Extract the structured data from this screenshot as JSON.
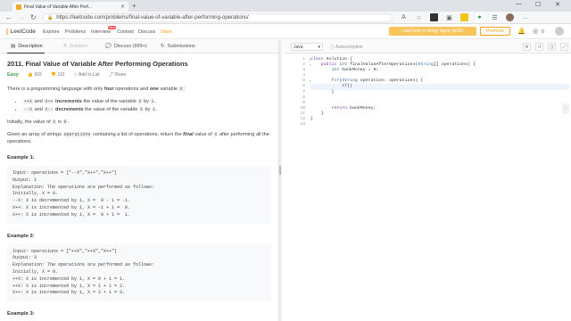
{
  "browser": {
    "tab_title": "Final Value of Variable After Perf...",
    "url": "https://leetcode.com/problems/final-value-of-variable-after-performing-operations/",
    "new_tab": "+",
    "win_min": "—",
    "win_max": "☐",
    "win_close": "✕"
  },
  "nav": {
    "logo": "LeetCode",
    "links": [
      "Explore",
      "Problems",
      "Interview",
      "Contest",
      "Discuss",
      "Store"
    ],
    "new_badge": "New",
    "promo": "LeetCode is hiring! Apply NOW.",
    "premium": "Premium",
    "coin_count": "0"
  },
  "left_tabs": {
    "description": "Description",
    "solution": "Solution",
    "discuss": "Discuss (999+)",
    "submissions": "Submissions"
  },
  "problem": {
    "title": "2011. Final Value of Variable After Performing Operations",
    "difficulty": "Easy",
    "likes": "692",
    "dislikes": "110",
    "add_to_list": "Add to List",
    "share": "Share",
    "intro_a": "There is a programming language with only ",
    "intro_b": "four",
    "intro_c": " operations and ",
    "intro_d": "one",
    "intro_e": " variable ",
    "intro_x": "X",
    "intro_f": ":",
    "bullet1_op1": "++X",
    "bullet1_and": " and ",
    "bullet1_op2": "X++",
    "bullet1_verb": " increments",
    "bullet1_rest": " the value of the variable ",
    "bullet1_x": "X",
    "bullet1_by": " by ",
    "bullet1_n": "1",
    "bullet2_op1": "--X",
    "bullet2_and": " and ",
    "bullet2_op2": "X--",
    "bullet2_verb": " decrements",
    "bullet2_rest": " the value of the variable ",
    "bullet2_x": "X",
    "bullet2_by": " by ",
    "bullet2_n": "1",
    "initial_a": "Initially, the value of ",
    "initial_x": "X",
    "initial_b": " is ",
    "initial_v": "0",
    "initial_c": ".",
    "given_a": "Given an array of strings ",
    "given_ops": "operations",
    "given_b": " containing a list of operations, return the ",
    "given_final": "final",
    "given_c": " value of ",
    "given_x": "X",
    "given_d": " after performing all the operations.",
    "example1_title": "Example 1:",
    "example1_box": "Input: operations = [\"--X\",\"X++\",\"X++\"]\nOutput: 1\nExplanation: The operations are performed as follows:\nInitially, X = 0.\n--X: X is decremented by 1, X =  0 - 1 = -1.\nX++: X is incremented by 1, X = -1 + 1 =  0.\nX++: X is incremented by 1, X =  0 + 1 =  1.",
    "example2_title": "Example 2:",
    "example2_box": "Input: operations = [\"++X\",\"++X\",\"X++\"]\nOutput: 3\nExplanation: The operations are performed as follows:\nInitially, X = 0.\n++X: X is incremented by 1, X = 0 + 1 = 1.\n++X: X is incremented by 1, X = 1 + 1 = 2.\nX++: X is incremented by 1, X = 2 + 1 = 3.",
    "example3_title": "Example 3:"
  },
  "editor": {
    "language": "Java",
    "autocomplete": "Autocomplete",
    "lines": [
      "class Solution {",
      "    public int finalValueAfterOperations(String[] operations) {",
      "        int bankMoney = 0;",
      "",
      "        for(String operation: operations) {",
      "            if()",
      "        }",
      "",
      "",
      "        return bankMoney;",
      "    }",
      "}",
      ""
    ],
    "active_line": 6
  }
}
